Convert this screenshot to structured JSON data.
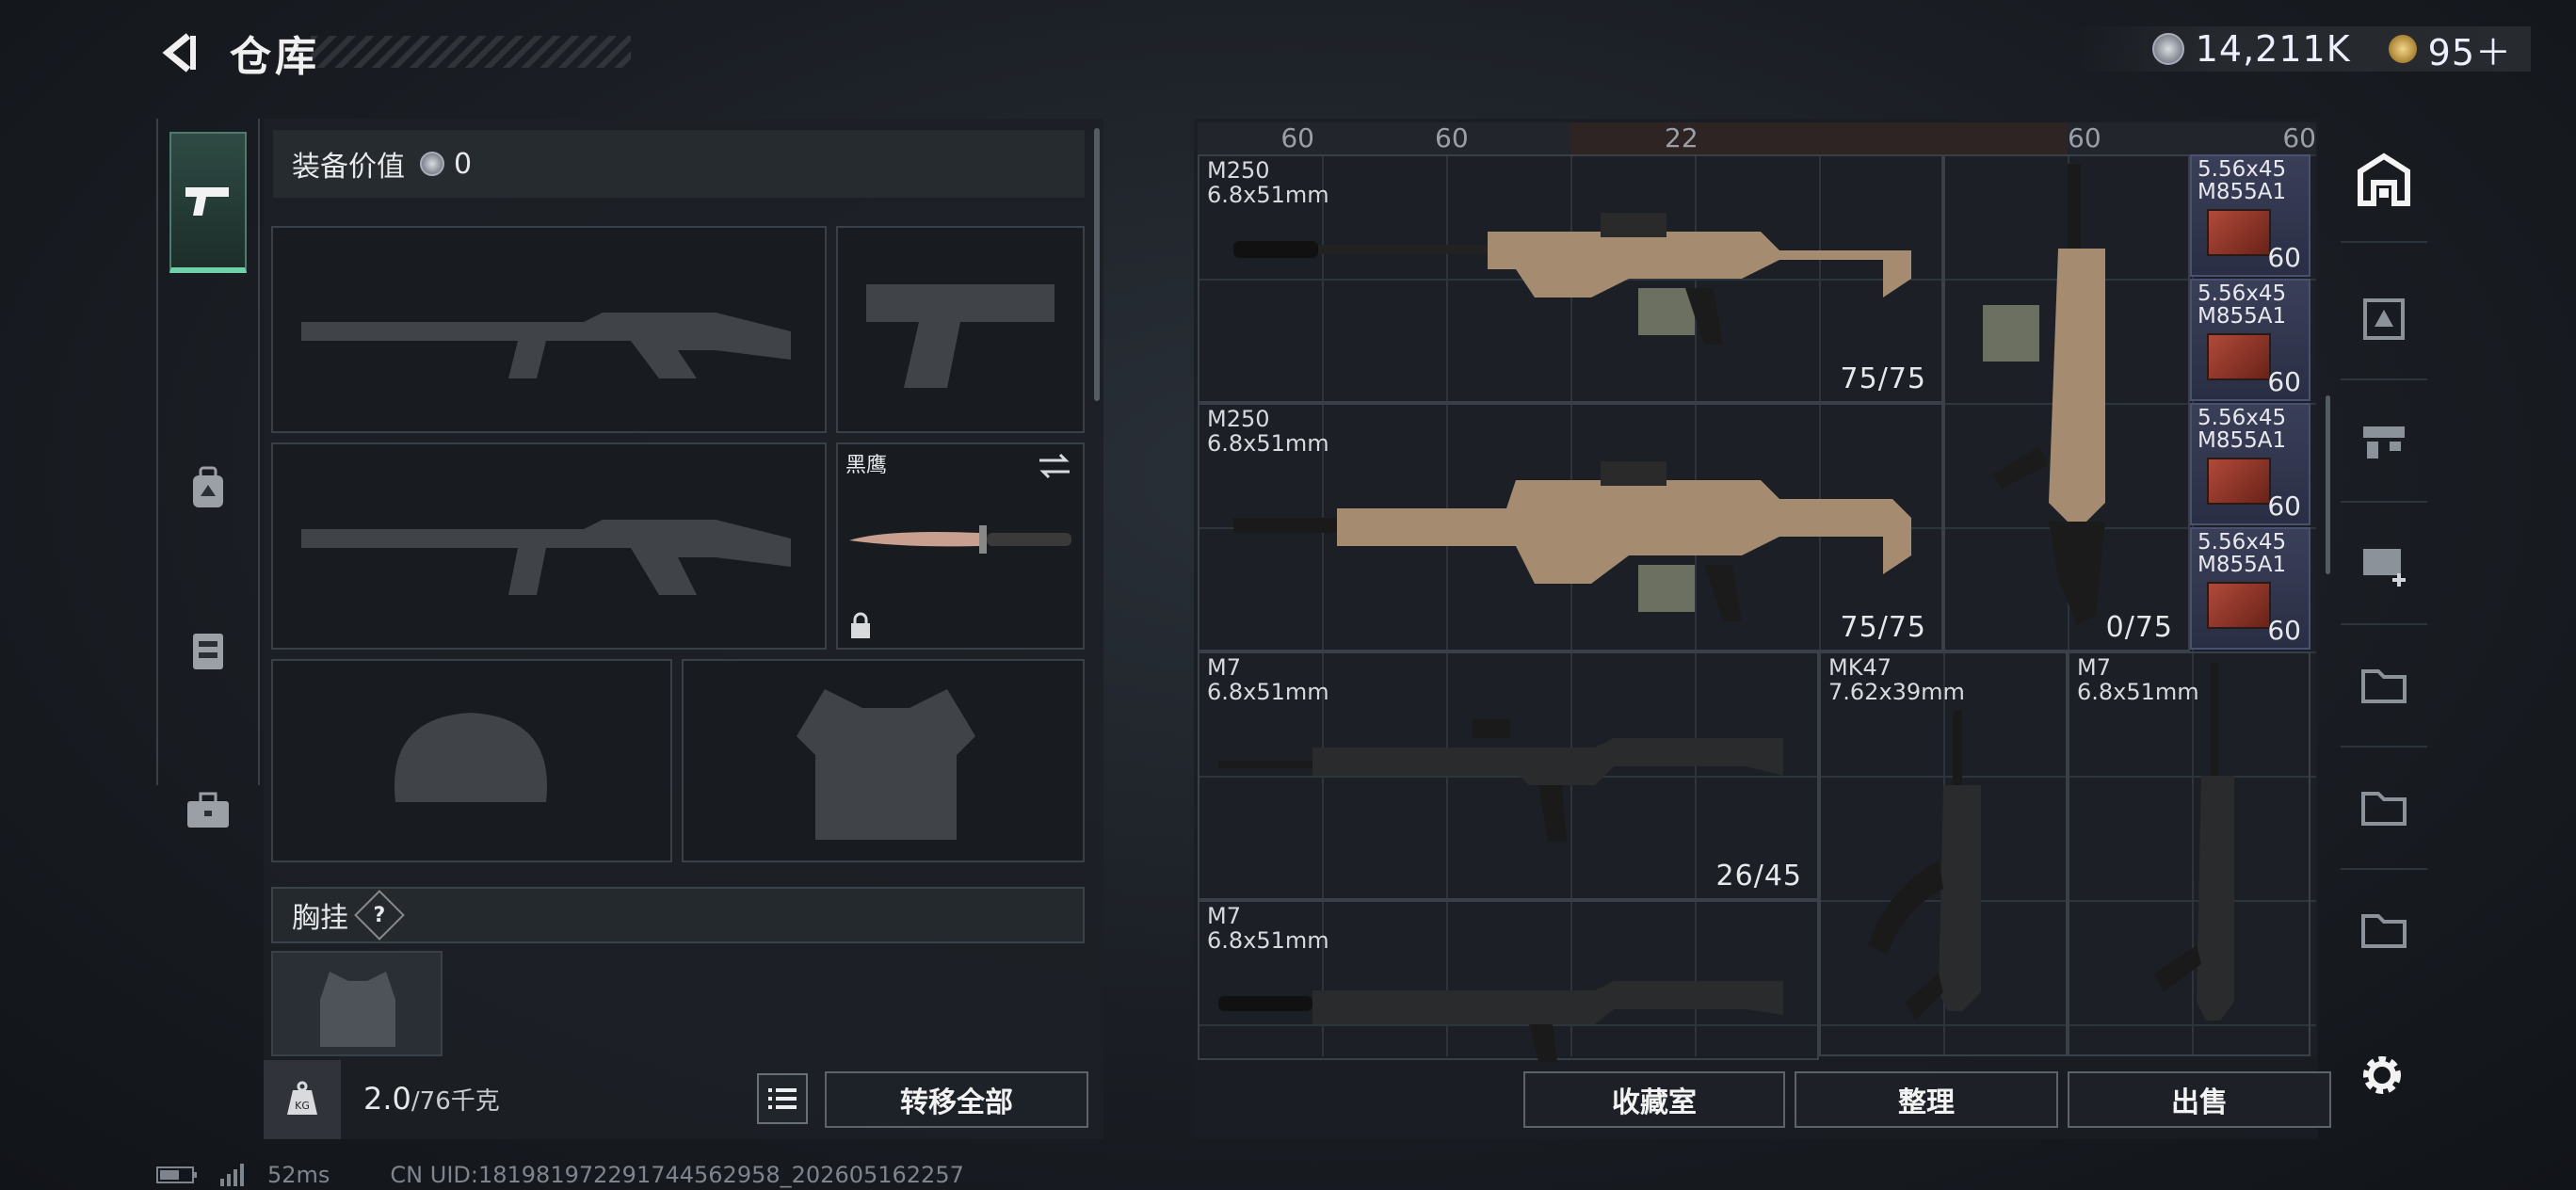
{
  "header": {
    "title": "仓库",
    "silver": "14,211K",
    "gold": "95＋"
  },
  "equipment": {
    "value_label": "装备价值",
    "value": "0",
    "knife_name": "黑鹰",
    "chest_label": "胸挂",
    "help": "?",
    "weight": "2.0",
    "weight_max": "/76千克",
    "transfer_all": "转移全部"
  },
  "storage": {
    "top_row": [
      "60",
      "60",
      "22",
      "60",
      "60"
    ],
    "weapons": [
      {
        "name": "M250",
        "caliber": "6.8x51mm",
        "ammo": "75/75"
      },
      {
        "name": "M250",
        "caliber": "6.8x51mm",
        "ammo": "75/75"
      },
      {
        "name": "",
        "caliber": "",
        "ammo": "0/75"
      },
      {
        "name": "M7",
        "caliber": "6.8x51mm",
        "ammo": "26/45"
      },
      {
        "name": "MK47",
        "caliber": "7.62x39mm",
        "ammo": ""
      },
      {
        "name": "M7",
        "caliber": "6.8x51mm",
        "ammo": ""
      },
      {
        "name": "M7",
        "caliber": "6.8x51mm",
        "ammo": ""
      }
    ],
    "ammo": [
      {
        "name": "5.56x45",
        "type": "M855A1",
        "count": "60"
      },
      {
        "name": "5.56x45",
        "type": "M855A1",
        "count": "60"
      },
      {
        "name": "5.56x45",
        "type": "M855A1",
        "count": "60"
      },
      {
        "name": "5.56x45",
        "type": "M855A1",
        "count": "60"
      }
    ],
    "buttons": {
      "collection": "收藏室",
      "organize": "整理",
      "sell": "出售"
    }
  },
  "status": {
    "ping": "52ms",
    "uid": "CN UID:181981972291744562958_202605162257"
  }
}
